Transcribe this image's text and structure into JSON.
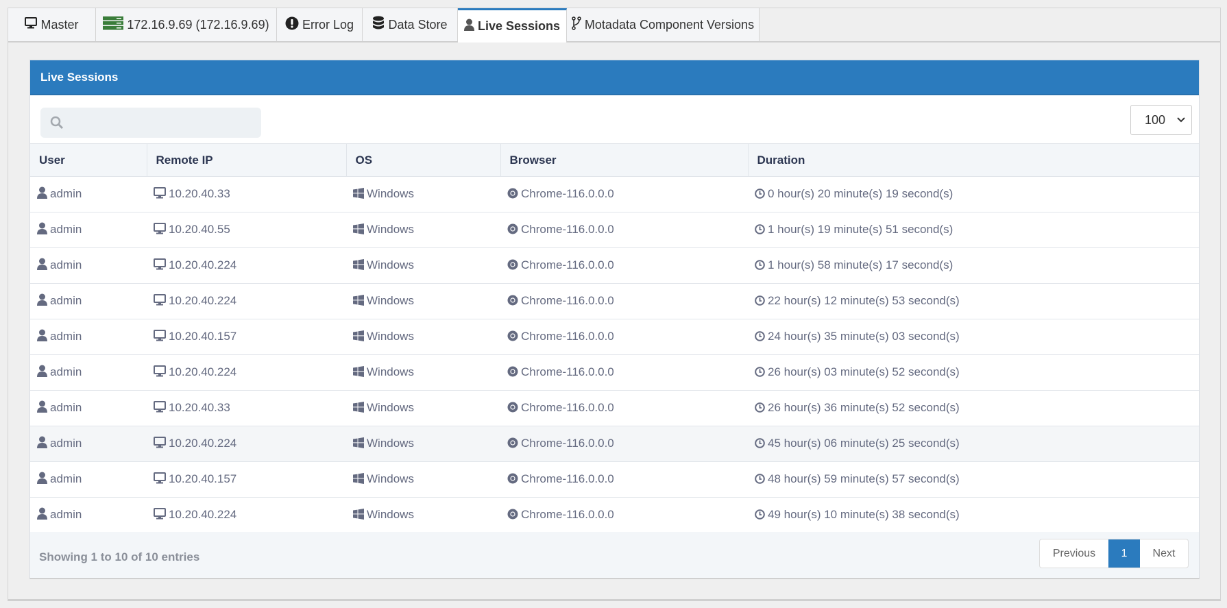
{
  "tabs": [
    {
      "label": "Master",
      "icon": "desktop-icon"
    },
    {
      "label": "172.16.9.69 (172.16.9.69)",
      "icon": "server-icon"
    },
    {
      "label": "Error Log",
      "icon": "exclamation-circle-icon"
    },
    {
      "label": "Data Store",
      "icon": "database-icon"
    },
    {
      "label": "Live Sessions",
      "icon": "user-icon",
      "active": true
    },
    {
      "label": "Motadata Component Versions",
      "icon": "code-branch-icon"
    }
  ],
  "panel": {
    "title": "Live Sessions",
    "search": {
      "placeholder": "",
      "value": ""
    },
    "page_size": "100"
  },
  "table": {
    "columns": [
      "User",
      "Remote IP",
      "OS",
      "Browser",
      "Duration"
    ],
    "rows": [
      [
        "admin",
        "10.20.40.33",
        "Windows",
        "Chrome-116.0.0.0",
        "0 hour(s) 20 minute(s) 19 second(s)"
      ],
      [
        "admin",
        "10.20.40.55",
        "Windows",
        "Chrome-116.0.0.0",
        "1 hour(s) 19 minute(s) 51 second(s)"
      ],
      [
        "admin",
        "10.20.40.224",
        "Windows",
        "Chrome-116.0.0.0",
        "1 hour(s) 58 minute(s) 17 second(s)"
      ],
      [
        "admin",
        "10.20.40.224",
        "Windows",
        "Chrome-116.0.0.0",
        "22 hour(s) 12 minute(s) 53 second(s)"
      ],
      [
        "admin",
        "10.20.40.157",
        "Windows",
        "Chrome-116.0.0.0",
        "24 hour(s) 35 minute(s) 03 second(s)"
      ],
      [
        "admin",
        "10.20.40.224",
        "Windows",
        "Chrome-116.0.0.0",
        "26 hour(s) 03 minute(s) 52 second(s)"
      ],
      [
        "admin",
        "10.20.40.33",
        "Windows",
        "Chrome-116.0.0.0",
        "26 hour(s) 36 minute(s) 52 second(s)"
      ],
      [
        "admin",
        "10.20.40.224",
        "Windows",
        "Chrome-116.0.0.0",
        "45 hour(s) 06 minute(s) 25 second(s)"
      ],
      [
        "admin",
        "10.20.40.157",
        "Windows",
        "Chrome-116.0.0.0",
        "48 hour(s) 59 minute(s) 57 second(s)"
      ],
      [
        "admin",
        "10.20.40.224",
        "Windows",
        "Chrome-116.0.0.0",
        "49 hour(s) 10 minute(s) 38 second(s)"
      ]
    ]
  },
  "footer": {
    "info": "Showing 1 to 10 of 10 entries",
    "previous": "Previous",
    "current_page": "1",
    "next": "Next"
  },
  "colors": {
    "accent": "#2b7bbe",
    "server_icon": "#3a7d3a"
  }
}
